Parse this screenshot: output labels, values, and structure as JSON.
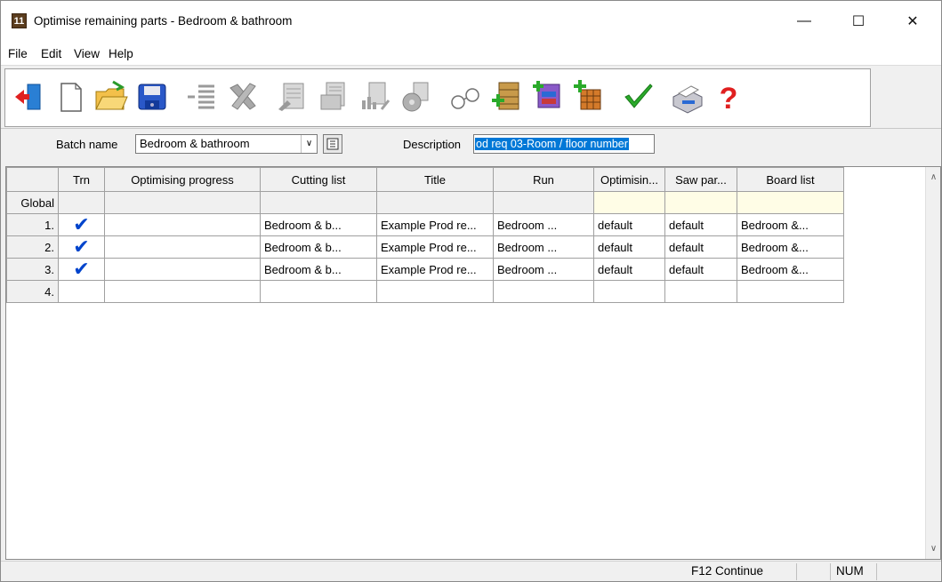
{
  "window": {
    "app_icon_text": "11",
    "title": "Optimise remaining parts - Bedroom & bathroom",
    "minimize": "—",
    "maximize": "☐",
    "close": "✕"
  },
  "menu": [
    "File",
    "Edit",
    "View",
    "Help"
  ],
  "toolbar": {
    "icons": [
      "exit-icon",
      "new-icon",
      "open-folder-icon",
      "save-icon",
      "list-icon",
      "delete-icon",
      "report-icon",
      "report-2-icon",
      "chart-report-icon",
      "saw-icon",
      "glasses-icon",
      "add-board-icon",
      "add-parts-icon",
      "add-grid-icon",
      "check-icon",
      "print-icon",
      "help-icon"
    ]
  },
  "batch": {
    "label": "Batch name",
    "value": "Bedroom & bathroom",
    "arrow": "∨",
    "description_label": "Description",
    "description_value": "od req 03-Room / floor number"
  },
  "grid": {
    "headers": [
      "",
      "Trn",
      "Optimising progress",
      "Cutting list",
      "Title",
      "Run",
      "Optimisin...",
      "Saw par...",
      "Board list"
    ],
    "global_row": {
      "label": "Global"
    },
    "rows": [
      {
        "num": "1.",
        "trn": "✔",
        "progress": "",
        "cutting": "Bedroom & b...",
        "title": "Example Prod re...",
        "run": "Bedroom ...",
        "opt": "default",
        "saw": "default",
        "board": "Bedroom &..."
      },
      {
        "num": "2.",
        "trn": "✔",
        "progress": "",
        "cutting": "Bedroom & b...",
        "title": "Example Prod re...",
        "run": "Bedroom ...",
        "opt": "default",
        "saw": "default",
        "board": "Bedroom &..."
      },
      {
        "num": "3.",
        "trn": "✔",
        "progress": "",
        "cutting": "Bedroom & b...",
        "title": "Example Prod re...",
        "run": "Bedroom ...",
        "opt": "default",
        "saw": "default",
        "board": "Bedroom &..."
      },
      {
        "num": "4.",
        "trn": "",
        "progress": "",
        "cutting": "",
        "title": "",
        "run": "",
        "opt": "",
        "saw": "",
        "board": ""
      }
    ],
    "scroll_up": "∧",
    "scroll_down": "∨"
  },
  "status": {
    "f12": "F12 Continue",
    "num": "NUM"
  },
  "colors": {
    "selection": "#0078d7",
    "global_yellow": "#fffde6",
    "check_blue": "#0044cc"
  }
}
